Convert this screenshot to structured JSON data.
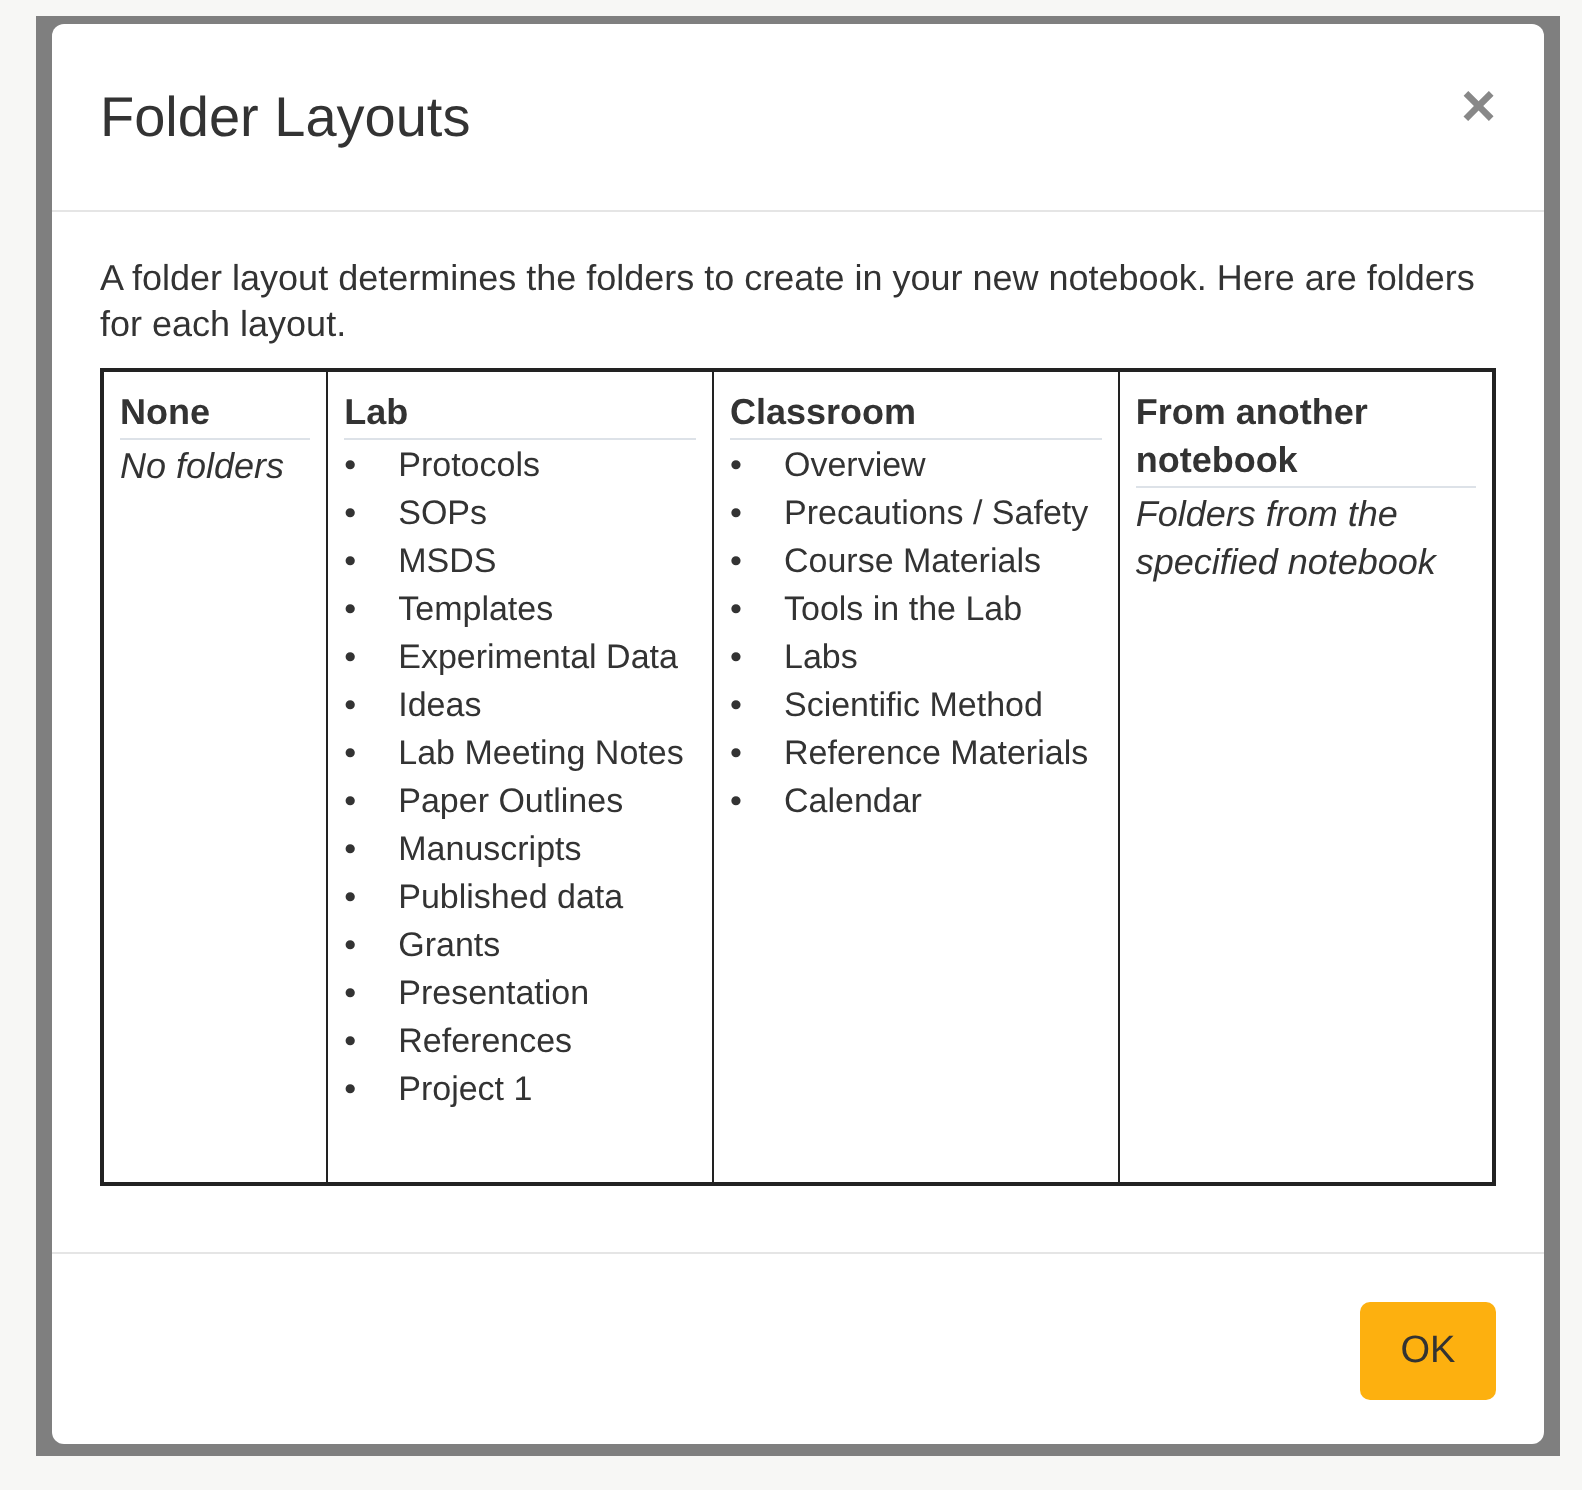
{
  "dialog": {
    "title": "Folder Layouts",
    "close": "×",
    "intro": "A folder layout determines the folders to create in your new notebook. Here are folders for each layout.",
    "layouts": [
      {
        "heading": "None",
        "kind": "text",
        "text": "No folders"
      },
      {
        "heading": "Lab",
        "kind": "list",
        "marker": "•",
        "items": [
          "Protocols",
          "SOPs",
          "MSDS",
          "Templates",
          "Experimental Data",
          "Ideas",
          "Lab Meeting Notes",
          "Paper Outlines",
          "Manuscripts",
          "Published data",
          "Grants",
          "Presentation",
          "References",
          "Project 1"
        ]
      },
      {
        "heading": "Classroom",
        "kind": "list",
        "marker": "•",
        "items": [
          "Overview",
          "Precautions / Safety",
          "Course Materials",
          "Tools in the Lab",
          "Labs",
          "Scientific Method",
          "Reference Materials",
          "Calendar"
        ]
      },
      {
        "heading": "From another notebook",
        "kind": "text",
        "text": "Folders from the specified notebook"
      }
    ],
    "buttons": [
      "OK"
    ]
  }
}
